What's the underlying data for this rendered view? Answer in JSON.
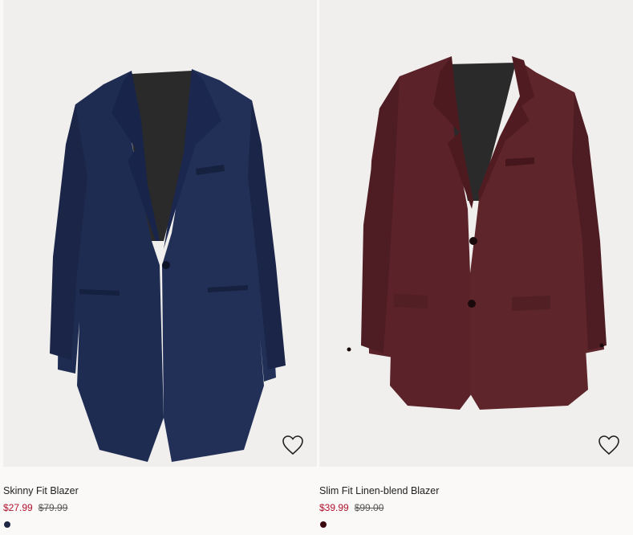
{
  "products": [
    {
      "name": "Skinny Fit Blazer",
      "sale_price": "$27.99",
      "original_price": "$79.99",
      "swatch_color": "#1f2744",
      "jacket_color": "#1f2c52",
      "favorite_icon": "heart-outline-icon"
    },
    {
      "name": "Slim Fit Linen-blend Blazer",
      "sale_price": "$39.99",
      "original_price": "$99.00",
      "swatch_color": "#3a0a10",
      "jacket_color": "#5b2329",
      "favorite_icon": "heart-outline-icon"
    }
  ],
  "colors": {
    "sale": "#b0102e",
    "background": "#faf9f8",
    "image_background": "#f0efed"
  }
}
